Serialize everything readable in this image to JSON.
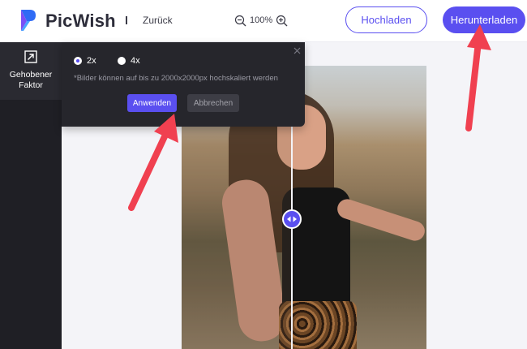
{
  "header": {
    "brand": "PicWish",
    "back_label": "Zurück",
    "zoom_level": "100%",
    "upload_label": "Hochladen",
    "download_label": "Herunterladen"
  },
  "sidebar": {
    "tool_label": "Gehobener\nFaktor",
    "tool_icon": "upscale-icon"
  },
  "popup": {
    "options": [
      {
        "label": "2x",
        "checked": true
      },
      {
        "label": "4x",
        "checked": false
      }
    ],
    "note": "*Bilder können auf bis zu 2000x2000px hochskaliert werden",
    "apply_label": "Anwenden",
    "cancel_label": "Abbrechen"
  },
  "colors": {
    "accent": "#5a4ff0",
    "annotation": "#f04050",
    "panel_dark": "#1f1f25"
  }
}
